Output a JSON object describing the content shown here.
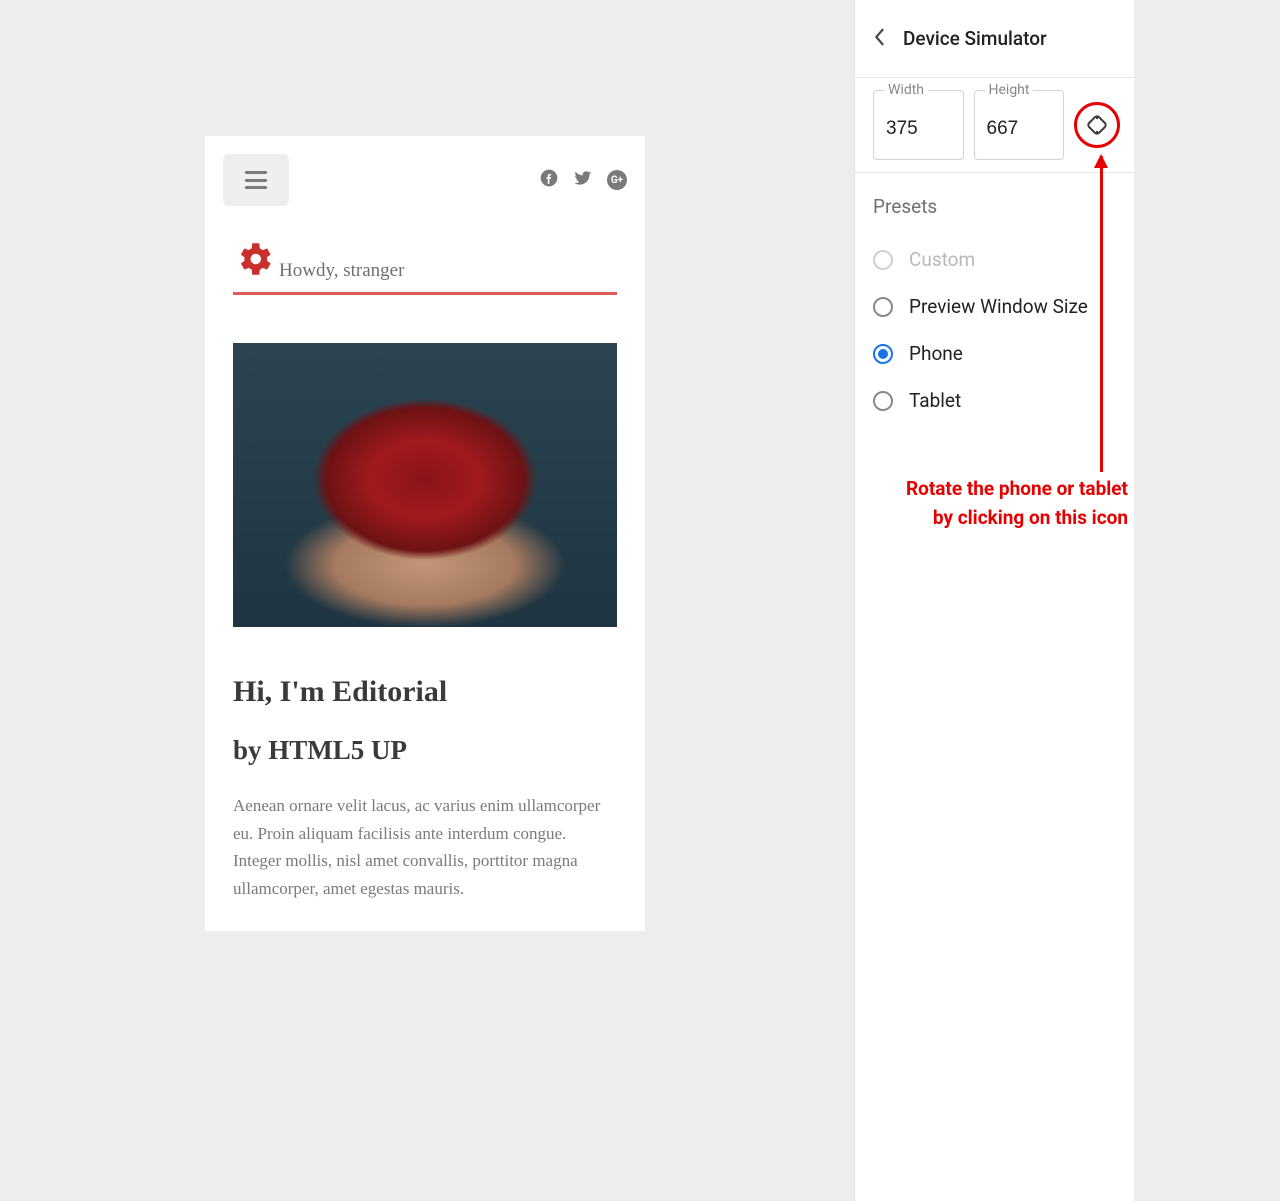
{
  "preview": {
    "greeting": "Howdy, stranger",
    "post_title": "Hi, I'm Editorial",
    "post_subtitle": "by HTML5 UP",
    "post_body": "Aenean ornare velit lacus, ac varius enim ullamcorper eu. Proin aliquam facilisis ante interdum congue. Integer mollis, nisl amet convallis, porttitor magna ullamcorper, amet egestas mauris."
  },
  "sidebar": {
    "title": "Device Simulator",
    "width_label": "Width",
    "height_label": "Height",
    "width_value": "375",
    "height_value": "667",
    "presets_heading": "Presets",
    "presets": {
      "custom": "Custom",
      "preview": "Preview Window Size",
      "phone": "Phone",
      "tablet": "Tablet"
    },
    "selected_preset": "phone"
  },
  "annotation": {
    "line1": "Rotate the phone or tablet",
    "line2": "by clicking on this icon"
  }
}
